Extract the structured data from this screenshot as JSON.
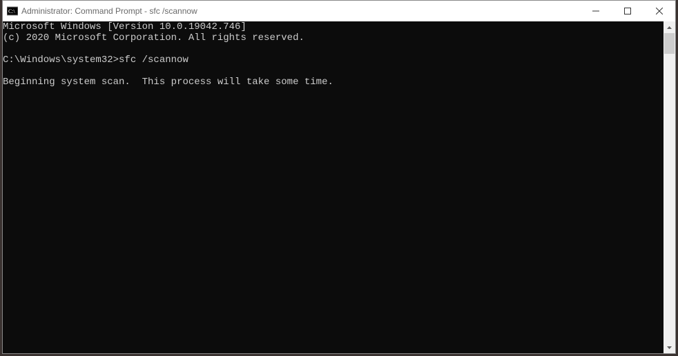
{
  "window": {
    "title": "Administrator: Command Prompt - sfc  /scannow"
  },
  "terminal": {
    "line1": "Microsoft Windows [Version 10.0.19042.746]",
    "line2": "(c) 2020 Microsoft Corporation. All rights reserved.",
    "blank1": "",
    "prompt_line": "C:\\Windows\\system32>sfc /scannow",
    "blank2": "",
    "status_line": "Beginning system scan.  This process will take some time."
  }
}
